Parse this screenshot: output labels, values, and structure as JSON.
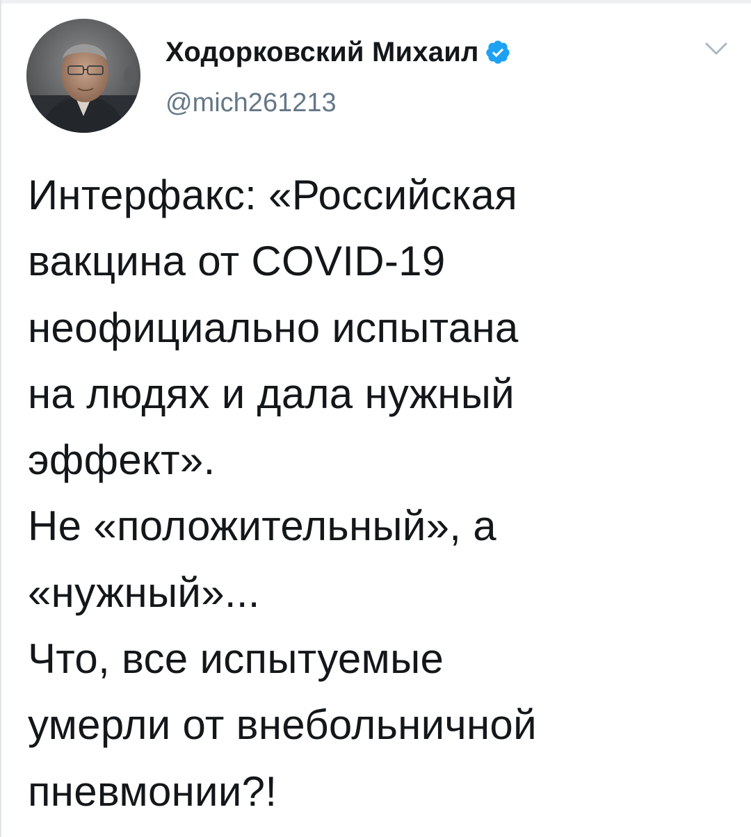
{
  "tweet": {
    "author": {
      "display_name": "Ходорковский Михаил",
      "handle": "@mich261213",
      "verified": true
    },
    "text_lines": [
      "Интерфакс: «Российская",
      "вакцина от COVID-19",
      "неофициально испытана",
      "на людях и дала нужный",
      "эффект».",
      "Не «положительный», а",
      "«нужный»...",
      "Что, все испытуемые",
      "умерли от внебольничной",
      "пневмонии?!"
    ]
  },
  "icons": {
    "verified_badge": "verified-badge-icon",
    "more_options": "chevron-down-icon"
  },
  "colors": {
    "verified_blue": "#1da1f2",
    "text_primary": "#14171a",
    "text_secondary": "#657786",
    "caret_gray": "#aab8c2"
  }
}
